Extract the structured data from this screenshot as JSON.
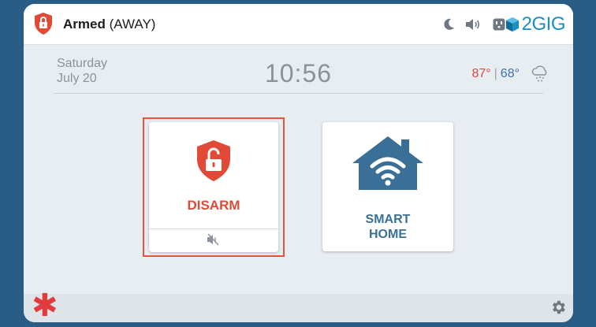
{
  "status": {
    "state": "Armed",
    "mode": "(AWAY)",
    "icons": [
      "moon-icon",
      "speaker-icon",
      "outlet-icon"
    ],
    "brand": "2GIG"
  },
  "info": {
    "day": "Saturday",
    "date": "July 20",
    "time": "10:56",
    "temp_high": "87°",
    "temp_sep": "|",
    "temp_low": "68°",
    "weather_icon": "snow-cloud-icon"
  },
  "tiles": {
    "disarm_label": "DISARM",
    "smart_line1": "SMART",
    "smart_line2": "HOME"
  },
  "colors": {
    "frame": "#2a5d86",
    "alert": "#e04a36",
    "smart": "#3a6f98",
    "brand": "#1b8fc3"
  }
}
